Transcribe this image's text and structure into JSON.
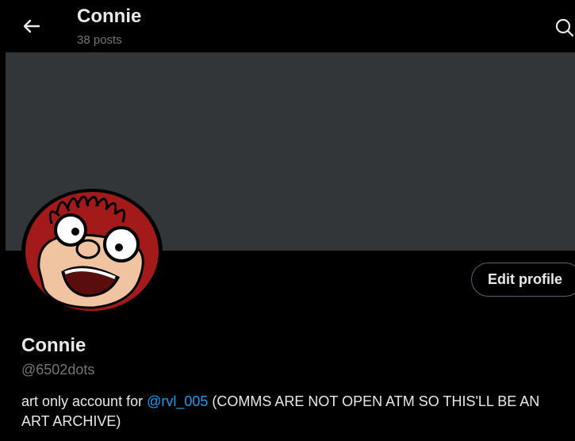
{
  "header": {
    "title": "Connie",
    "post_count": "38 posts",
    "back_icon": "arrow-left-icon",
    "search_icon": "search-icon"
  },
  "profile": {
    "edit_button_label": "Edit profile",
    "display_name": "Connie",
    "handle": "@6502dots",
    "bio_prefix": "art only account for ",
    "bio_mention": "@rvl_005",
    "bio_suffix": " (COMMS ARE NOT OPEN ATM SO THIS'LL BE AN ART ARCHIVE)"
  },
  "colors": {
    "background": "#000000",
    "banner": "#333639",
    "text_primary": "#e7e9ea",
    "text_secondary": "#71767b",
    "link": "#1d9bf0",
    "button_border": "#536471",
    "avatar_hair": "#a31a1a",
    "avatar_skin": "#f0c4a0"
  }
}
